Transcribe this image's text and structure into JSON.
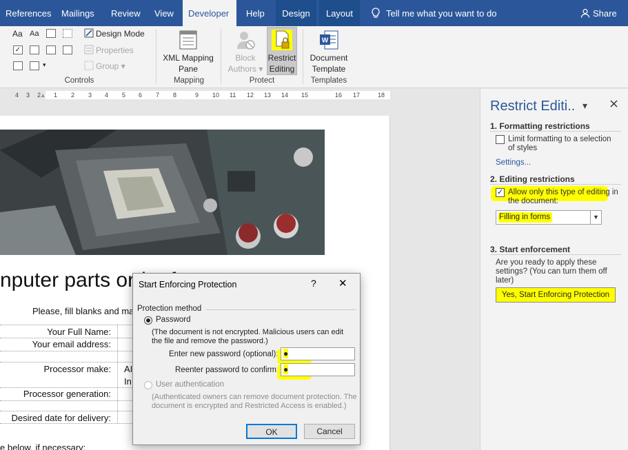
{
  "tabs": [
    {
      "label": "References",
      "active": false
    },
    {
      "label": "Mailings",
      "active": false
    },
    {
      "label": "Review",
      "active": false
    },
    {
      "label": "View",
      "active": false
    },
    {
      "label": "Developer",
      "active": true
    },
    {
      "label": "Help",
      "active": false
    },
    {
      "label": "Design",
      "active": false
    },
    {
      "label": "Layout",
      "active": false
    }
  ],
  "tell_me": "Tell me what you want to do",
  "share": "Share",
  "ribbon": {
    "controls": {
      "label": "Controls",
      "design_mode": "Design Mode",
      "properties": "Properties",
      "group": "Group"
    },
    "mapping": {
      "label": "Mapping",
      "xml_mapping_line1": "XML Mapping",
      "xml_mapping_line2": "Pane"
    },
    "protect": {
      "label": "Protect",
      "block_authors_line1": "Block",
      "block_authors_line2": "Authors",
      "restrict_line1": "Restrict",
      "restrict_line2": "Editing"
    },
    "templates": {
      "label": "Templates",
      "doc_template_line1": "Document",
      "doc_template_line2": "Template"
    }
  },
  "ruler": {
    "marks": [
      "4",
      "3",
      "2",
      "1",
      "1",
      "2",
      "3",
      "4",
      "5",
      "6",
      "7",
      "8",
      "9",
      "10",
      "11",
      "12",
      "13",
      "14",
      "15",
      "16",
      "17",
      "18"
    ]
  },
  "document": {
    "title": "nputer parts order form",
    "instructions": "Please, fill blanks and ma",
    "fields": [
      {
        "label": "Your Full Name:",
        "value": ""
      },
      {
        "label": "Your email address:",
        "value": ""
      },
      {
        "label": "Processor make:",
        "value": "AI"
      },
      {
        "label": "",
        "value": "In"
      },
      {
        "label": "Processor generation:",
        "value": ""
      },
      {
        "label": "Desired date for delivery:",
        "value": ""
      }
    ],
    "bottom_text": "e below, if necessary:"
  },
  "pane": {
    "title": "Restrict Editi..",
    "formatting": {
      "heading": "1. Formatting restrictions",
      "checkbox_label": "Limit formatting to a selection of styles",
      "checked": false,
      "settings_link": "Settings..."
    },
    "editing": {
      "heading": "2. Editing restrictions",
      "checkbox_label": "Allow only this type of editing in the document:",
      "checked": true,
      "selected_option": "Filling in forms"
    },
    "enforcement": {
      "heading": "3. Start enforcement",
      "description": "Are you ready to apply these settings? (You can turn them off later)",
      "button": "Yes, Start Enforcing Protection"
    }
  },
  "dialog": {
    "title": "Start Enforcing Protection",
    "help": "?",
    "close": "✕",
    "group_label": "Protection method",
    "password_option": "Password",
    "password_selected": true,
    "password_note": "(The document is not encrypted. Malicious users can edit the file and remove the password.)",
    "new_password_label": "Enter new password (optional):",
    "new_password_value": "●",
    "confirm_password_label": "Reenter password to confirm:",
    "confirm_password_value": "●",
    "user_auth_option": "User authentication",
    "user_auth_note": "(Authenticated owners can remove document protection. The document is encrypted and Restricted Access is enabled.)",
    "ok": "OK",
    "cancel": "Cancel"
  },
  "colors": {
    "ribbon_blue": "#2b579a",
    "highlight": "#ffff00",
    "dialog_focus": "#0078d7"
  }
}
